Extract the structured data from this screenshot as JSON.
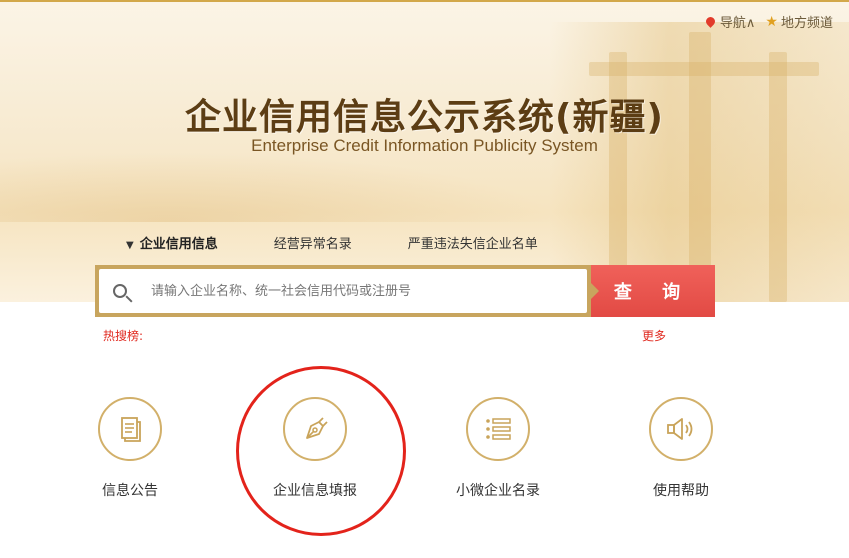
{
  "topnav": {
    "nav_label": "导航∧",
    "local_label": "地方频道"
  },
  "header": {
    "title_cn": "企业信用信息公示系统(新疆)",
    "title_en": "Enterprise Credit Information Publicity System"
  },
  "tabs": [
    {
      "label": "企业信用信息",
      "active": true
    },
    {
      "label": "经营异常名录",
      "active": false
    },
    {
      "label": "严重违法失信企业名单",
      "active": false
    }
  ],
  "search": {
    "placeholder": "请输入企业名称、统一社会信用代码或注册号",
    "button_label": "查 询"
  },
  "hot": {
    "label": "热搜榜:",
    "more_label": "更多"
  },
  "features": [
    {
      "label": "信息公告",
      "icon": "document-icon"
    },
    {
      "label": "企业信息填报",
      "icon": "pen-nib-icon"
    },
    {
      "label": "小微企业名录",
      "icon": "list-icon"
    },
    {
      "label": "使用帮助",
      "icon": "speaker-icon"
    }
  ],
  "colors": {
    "accent_gold": "#c8a55e",
    "search_red": "#e24a44",
    "hot_red": "#e02a20",
    "highlight_red": "#e3231b"
  }
}
